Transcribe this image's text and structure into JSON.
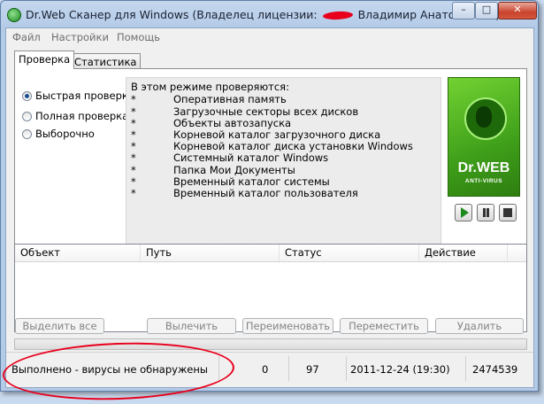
{
  "window": {
    "title_before": "Dr.Web Сканер для Windows (Владелец лицензии:",
    "title_after": "Владимир Анатольевич)",
    "controls": {
      "minimize": "–",
      "maximize": "□",
      "close": "✕"
    }
  },
  "menu": [
    "Файл",
    "Настройки",
    "Помощь"
  ],
  "tabs": [
    {
      "label": "Проверка",
      "active": true
    },
    {
      "label": "Статистика",
      "active": false
    }
  ],
  "scan_modes": [
    {
      "label": "Быстрая проверка",
      "selected": true
    },
    {
      "label": "Полная проверка",
      "selected": false
    },
    {
      "label": "Выборочно",
      "selected": false
    }
  ],
  "info": {
    "heading": "В этом режиме проверяются:",
    "bullet": "*",
    "items": [
      "Оперативная память",
      "Загрузочные секторы всех дисков",
      "Объекты автозапуска",
      "Корневой каталог загрузочного диска",
      "Корневой каталог диска установки Windows",
      "Системный каталог Windows",
      "Папка Мои Документы",
      "Временный каталог системы",
      "Временный каталог пользователя"
    ]
  },
  "logo": {
    "text": "Dr.WEB",
    "sub": "ANTI-VIRUS"
  },
  "list_columns": [
    "Объект",
    "Путь",
    "Статус",
    "Действие"
  ],
  "buttons": [
    "Выделить все",
    "Вылечить",
    "Переименовать",
    "Переместить",
    "Удалить"
  ],
  "progress": {
    "fraction": 0
  },
  "status": {
    "message": "Выполнено - вирусы не обнаружены",
    "found": "0",
    "checked": "97",
    "datetime": "2011-12-24 (19:30)",
    "bases": "2474539"
  },
  "annotation_color": "#e8001c"
}
